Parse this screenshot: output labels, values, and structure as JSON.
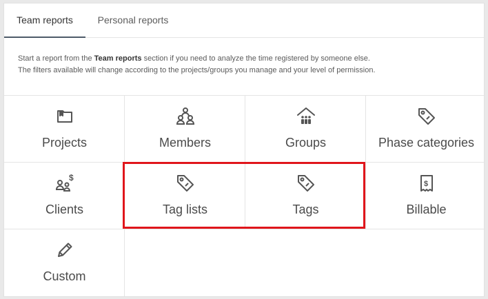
{
  "tabs": [
    {
      "label": "Team reports",
      "active": true
    },
    {
      "label": "Personal reports",
      "active": false
    }
  ],
  "description": {
    "line1_prefix": "Start a report from the ",
    "line1_bold": "Team reports",
    "line1_suffix": " section if you need to analyze the time registered by someone else.",
    "line2": "The filters available will change according to the projects/groups you manage and your level of permission."
  },
  "tiles": [
    {
      "label": "Projects",
      "icon": "folder-icon"
    },
    {
      "label": "Members",
      "icon": "members-icon"
    },
    {
      "label": "Groups",
      "icon": "groups-icon"
    },
    {
      "label": "Phase categories",
      "icon": "tag-icon"
    },
    {
      "label": "Clients",
      "icon": "clients-icon"
    },
    {
      "label": "Tag lists",
      "icon": "tag-icon"
    },
    {
      "label": "Tags",
      "icon": "tag-icon"
    },
    {
      "label": "Billable",
      "icon": "receipt-icon"
    },
    {
      "label": "Custom",
      "icon": "pencil-icon"
    }
  ],
  "colors": {
    "highlight": "#e0151b",
    "icon": "#555555",
    "text": "#4a4a4a"
  }
}
